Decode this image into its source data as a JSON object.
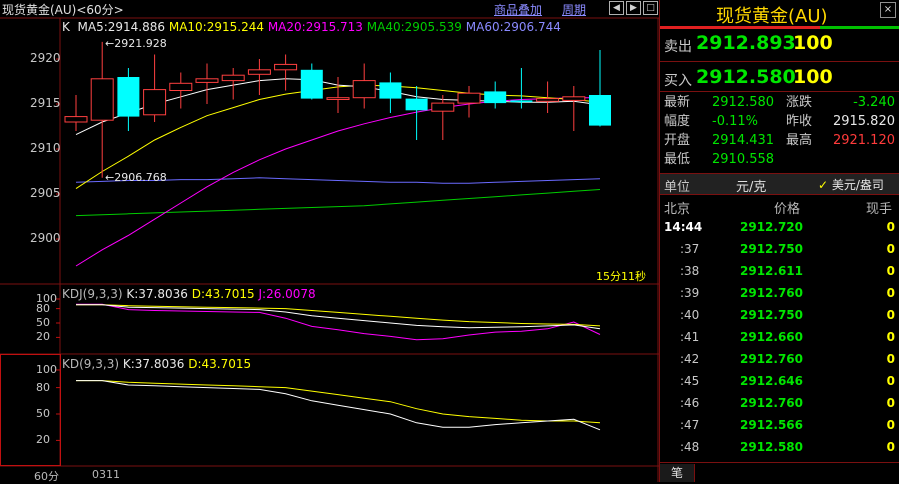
{
  "header": {
    "title": "现货黄金(AU)<60分>",
    "btn_overlay": "商品叠加",
    "btn_period": "周期"
  },
  "main_legend": {
    "k": "K",
    "ma5": "MA5:2914.886",
    "ma10": "MA10:2915.244",
    "ma20": "MA20:2915.713",
    "ma40": "MA40:2905.539",
    "ma60": "MA60:2906.744"
  },
  "annotations": {
    "high": "2921.928",
    "low": "2906.768",
    "countdown": "15分11秒"
  },
  "kdj_legend": {
    "name": "KDJ(9,3,3)",
    "k": "K:37.8036",
    "d": "D:43.7015",
    "j": "J:26.0078"
  },
  "kd_legend": {
    "name": "KD(9,3,3)",
    "k": "K:37.8036",
    "d": "D:43.7015"
  },
  "footer": {
    "period": "60分",
    "date": "0311"
  },
  "price_axis": [
    "2920",
    "2915",
    "2910",
    "2905",
    "2900"
  ],
  "kdj_axis": [
    "100",
    "80",
    "50",
    "20"
  ],
  "kd_axis": [
    "100",
    "80",
    "50",
    "20"
  ],
  "colors": {
    "up": "#ff4040",
    "down": "#00ffff",
    "ma5": "#ffffff",
    "ma10": "#ffff00",
    "ma20": "#ff00ff",
    "ma40": "#00cc00",
    "ma60": "#6a6aff",
    "border": "#7a1010"
  },
  "candles": [
    {
      "o": 2913.0,
      "h": 2916.0,
      "l": 2912.0,
      "c": 2913.6
    },
    {
      "o": 2913.2,
      "h": 2921.9,
      "l": 2906.8,
      "c": 2917.8
    },
    {
      "o": 2918.0,
      "h": 2919.0,
      "l": 2912.0,
      "c": 2913.6
    },
    {
      "o": 2913.8,
      "h": 2920.5,
      "l": 2913.0,
      "c": 2916.6
    },
    {
      "o": 2916.5,
      "h": 2918.5,
      "l": 2914.5,
      "c": 2917.3
    },
    {
      "o": 2917.4,
      "h": 2919.5,
      "l": 2915.0,
      "c": 2917.8
    },
    {
      "o": 2917.6,
      "h": 2919.0,
      "l": 2915.5,
      "c": 2918.2
    },
    {
      "o": 2918.3,
      "h": 2920.0,
      "l": 2916.0,
      "c": 2918.8
    },
    {
      "o": 2918.8,
      "h": 2920.5,
      "l": 2916.5,
      "c": 2919.4
    },
    {
      "o": 2918.8,
      "h": 2919.5,
      "l": 2915.5,
      "c": 2915.6
    },
    {
      "o": 2915.5,
      "h": 2918.0,
      "l": 2914.0,
      "c": 2915.7
    },
    {
      "o": 2915.7,
      "h": 2919.5,
      "l": 2914.5,
      "c": 2917.6
    },
    {
      "o": 2917.4,
      "h": 2918.5,
      "l": 2914.0,
      "c": 2915.6
    },
    {
      "o": 2915.6,
      "h": 2917.0,
      "l": 2911.0,
      "c": 2914.3
    },
    {
      "o": 2914.2,
      "h": 2916.0,
      "l": 2911.0,
      "c": 2915.1
    },
    {
      "o": 2915.1,
      "h": 2917.0,
      "l": 2913.5,
      "c": 2916.2
    },
    {
      "o": 2916.4,
      "h": 2917.5,
      "l": 2914.5,
      "c": 2915.1
    },
    {
      "o": 2915.4,
      "h": 2919.0,
      "l": 2914.5,
      "c": 2915.2
    },
    {
      "o": 2915.3,
      "h": 2917.5,
      "l": 2914.0,
      "c": 2915.6
    },
    {
      "o": 2915.4,
      "h": 2917.0,
      "l": 2912.0,
      "c": 2915.8
    },
    {
      "o": 2916.0,
      "h": 2921.0,
      "l": 2912.5,
      "c": 2912.6
    }
  ],
  "ma5_line": [
    2911.6,
    2913.0,
    2914.0,
    2915.0,
    2915.8,
    2916.6,
    2917.1,
    2917.6,
    2917.8,
    2917.7,
    2917.1,
    2916.9,
    2916.4,
    2915.8,
    2915.5,
    2915.4,
    2915.3,
    2915.2,
    2915.2,
    2915.3,
    2914.9
  ],
  "ma10_line": [
    2905.6,
    2907.5,
    2909.2,
    2911.0,
    2912.4,
    2913.7,
    2914.6,
    2915.5,
    2916.1,
    2916.5,
    2916.9,
    2917.1,
    2917.0,
    2916.8,
    2916.5,
    2916.2,
    2916.0,
    2915.9,
    2915.7,
    2915.5,
    2915.2
  ],
  "ma20_line": [
    2897.0,
    2898.8,
    2900.4,
    2902.2,
    2904.0,
    2905.8,
    2907.4,
    2908.8,
    2910.0,
    2911.0,
    2912.0,
    2912.8,
    2913.5,
    2914.1,
    2914.6,
    2915.0,
    2915.3,
    2915.5,
    2915.6,
    2915.7,
    2915.7
  ],
  "ma40_line": [
    2902.6,
    2902.7,
    2902.8,
    2902.9,
    2903.0,
    2903.1,
    2903.2,
    2903.3,
    2903.4,
    2903.5,
    2903.6,
    2903.7,
    2903.9,
    2904.1,
    2904.3,
    2904.5,
    2904.7,
    2904.9,
    2905.1,
    2905.3,
    2905.5
  ],
  "ma60_line": [
    2906.3,
    2906.4,
    2906.5,
    2906.5,
    2906.6,
    2906.6,
    2906.7,
    2906.8,
    2906.7,
    2906.6,
    2906.5,
    2906.4,
    2906.3,
    2906.3,
    2906.2,
    2906.2,
    2906.3,
    2906.4,
    2906.5,
    2906.6,
    2906.7
  ],
  "kdj_k": [
    88,
    88,
    83,
    82,
    81,
    80,
    79,
    78,
    73,
    65,
    60,
    55,
    50,
    45,
    42,
    40,
    41,
    42,
    44,
    46,
    38
  ],
  "kdj_d": [
    88,
    88,
    86,
    85,
    84,
    83,
    82,
    81,
    80,
    76,
    72,
    68,
    64,
    60,
    56,
    53,
    51,
    49,
    48,
    47,
    44
  ],
  "kdj_j": [
    89,
    89,
    78,
    76,
    75,
    74,
    73,
    72,
    60,
    43,
    36,
    28,
    22,
    15,
    17,
    25,
    31,
    33,
    38,
    52,
    26
  ],
  "kd_k": [
    88,
    88,
    83,
    82,
    81,
    80,
    79,
    78,
    73,
    65,
    60,
    55,
    50,
    40,
    35,
    35,
    38,
    40,
    42,
    44,
    32
  ],
  "kd_d": [
    88,
    88,
    86,
    85,
    84,
    83,
    82,
    81,
    80,
    76,
    72,
    68,
    64,
    56,
    50,
    47,
    45,
    43,
    42,
    42,
    40
  ],
  "quote": {
    "title": "现货黄金(AU)",
    "sell_label": "卖出",
    "sell_price": "2912.893",
    "sell_vol": "100",
    "buy_label": "买入",
    "buy_price": "2912.580",
    "buy_vol": "100",
    "stats": [
      {
        "l1": "最新",
        "v1": "2912.580",
        "l2": "涨跌",
        "v2": "-3.240"
      },
      {
        "l1": "幅度",
        "v1": "-0.11%",
        "l2": "昨收",
        "v2": "2915.820"
      },
      {
        "l1": "开盘",
        "v1": "2914.431",
        "l2": "最高",
        "v2": "2921.120"
      },
      {
        "l1": "最低",
        "v1": "2910.558",
        "l2": "",
        "v2": ""
      }
    ],
    "unit_label": "单位",
    "unit_value": "元/克",
    "unit_option": "美元/盎司",
    "col_city": "北京",
    "col_price": "价格",
    "col_vol": "现手",
    "ticks": [
      {
        "t": "14:44",
        "p": "2912.720",
        "v": "0"
      },
      {
        "t": ":37",
        "p": "2912.750",
        "v": "0"
      },
      {
        "t": ":38",
        "p": "2912.611",
        "v": "0"
      },
      {
        "t": ":39",
        "p": "2912.760",
        "v": "0"
      },
      {
        "t": ":40",
        "p": "2912.750",
        "v": "0"
      },
      {
        "t": ":41",
        "p": "2912.660",
        "v": "0"
      },
      {
        "t": ":42",
        "p": "2912.760",
        "v": "0"
      },
      {
        "t": ":45",
        "p": "2912.646",
        "v": "0"
      },
      {
        "t": ":46",
        "p": "2912.760",
        "v": "0"
      },
      {
        "t": ":47",
        "p": "2912.566",
        "v": "0"
      },
      {
        "t": ":48",
        "p": "2912.580",
        "v": "0"
      }
    ],
    "bottom_tab": "笔"
  }
}
